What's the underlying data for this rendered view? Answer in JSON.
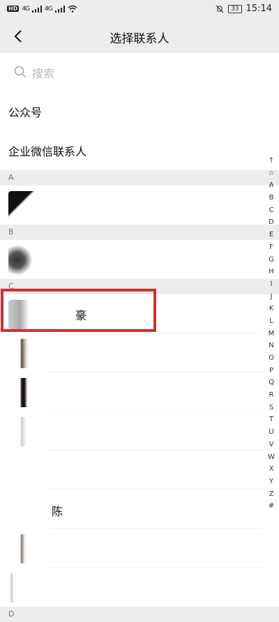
{
  "status_bar": {
    "left": {
      "hd_badge": "HD",
      "network1": "4G",
      "network2": "4G"
    },
    "right": {
      "battery": "33",
      "time": "15:14"
    }
  },
  "header": {
    "title": "选择联系人"
  },
  "search": {
    "placeholder": "搜索"
  },
  "special_items": [
    {
      "label": "公众号"
    },
    {
      "label": "企业微信联系人"
    }
  ],
  "sections": [
    {
      "letter": "A"
    },
    {
      "letter": "B"
    },
    {
      "letter": "C"
    },
    {
      "letter": "D"
    }
  ],
  "contacts": {
    "c_highlighted_name": "豪",
    "partial_name": "陈"
  },
  "index_bar": [
    "↑",
    "☆",
    "A",
    "B",
    "C",
    "D",
    "E",
    "F",
    "G",
    "H",
    "I",
    "J",
    "K",
    "L",
    "M",
    "N",
    "O",
    "P",
    "Q",
    "R",
    "S",
    "T",
    "U",
    "V",
    "W",
    "X",
    "Y",
    "Z",
    "#"
  ],
  "colors": {
    "highlight_border": "#c83337",
    "header_bg": "#ededed"
  }
}
